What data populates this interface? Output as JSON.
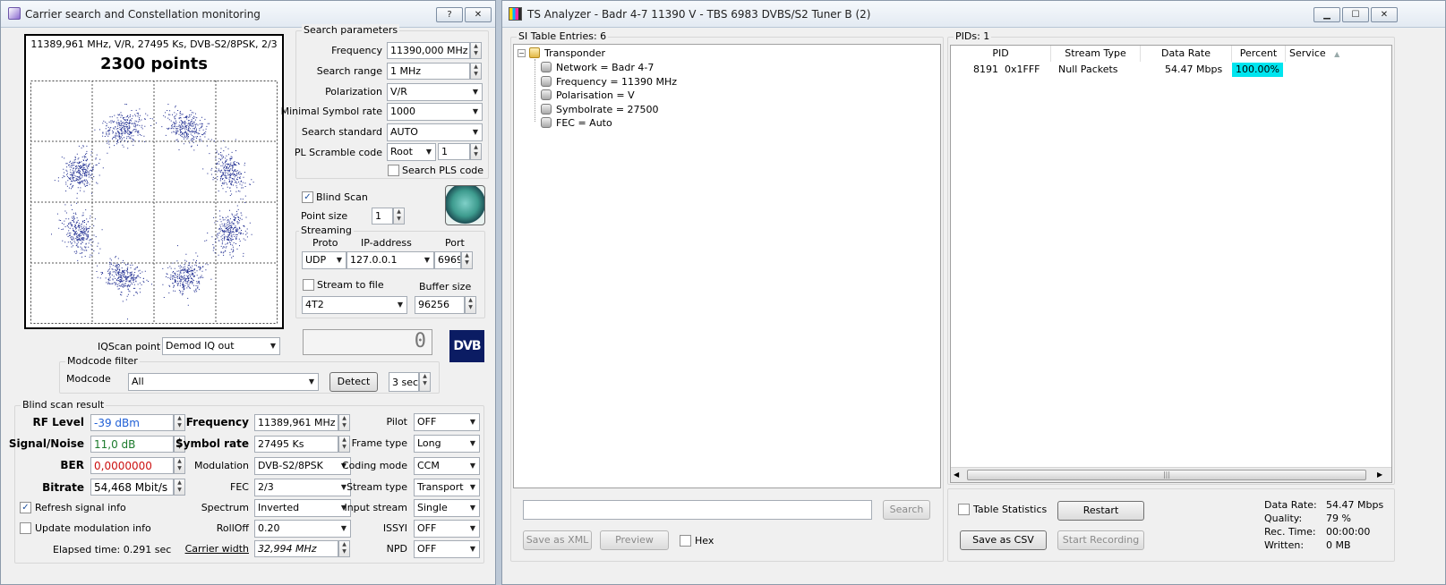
{
  "left": {
    "title": "Carrier search and Constellation monitoring",
    "help_button": "?",
    "info": "11389,961 MHz, V/R, 27495 Ks, DVB-S2/8PSK, 2/3",
    "points": "2300 points",
    "search": {
      "group": "Search parameters",
      "frequency_label": "Frequency",
      "frequency": "11390,000 MHz",
      "range_label": "Search range",
      "range": "1 MHz",
      "polarization_label": "Polarization",
      "polarization": "V/R",
      "minsr_label": "Minimal Symbol rate",
      "minsr": "1000",
      "standard_label": "Search standard",
      "standard": "AUTO",
      "pls_label": "PL Scramble code",
      "pls_mode": "Root",
      "pls_value": "1",
      "search_pls": "Search PLS code"
    },
    "blind_scan": "Blind Scan",
    "point_size_label": "Point size",
    "point_size": "1",
    "streaming": {
      "group": "Streaming",
      "proto_label": "Proto",
      "ip_label": "IP-address",
      "port_label": "Port",
      "proto": "UDP",
      "ip": "127.0.0.1",
      "port": "6969",
      "to_file": "Stream to file",
      "buffer_label": "Buffer size",
      "format": "4T2",
      "buffer": "96256"
    },
    "digit": "0",
    "dvb_logo": "DVB",
    "iqscan_label": "IQScan point",
    "iqscan": "Demod IQ out",
    "modcode": {
      "group": "Modcode filter",
      "label": "Modcode",
      "value": "All",
      "detect": "Detect",
      "sec": "3 sec"
    },
    "result": {
      "group": "Blind scan result",
      "rf_label": "RF Level",
      "rf": "-39 dBm",
      "sn_label": "Signal/Noise",
      "sn": "11,0 dB",
      "ber_label": "BER",
      "ber": "0,0000000",
      "bitrate_label": "Bitrate",
      "bitrate": "54,468 Mbit/s",
      "freq_label": "Frequency",
      "freq": "11389,961 MHz",
      "sr_label": "Symbol rate",
      "sr": "27495 Ks",
      "mod_label": "Modulation",
      "mod": "DVB-S2/8PSK",
      "fec_label": "FEC",
      "fec": "2/3",
      "spectrum_label": "Spectrum",
      "spectrum": "Inverted",
      "rolloff_label": "RollOff",
      "rolloff": "0.20",
      "cw_label": "Carrier width",
      "cw": "32,994 MHz",
      "pilot_label": "Pilot",
      "pilot": "OFF",
      "frametype_label": "Frame type",
      "frametype": "Long",
      "codingmode_label": "Coding mode",
      "codingmode": "CCM",
      "streamtype_label": "Stream type",
      "streamtype": "Transport",
      "inputstream_label": "Input stream",
      "inputstream": "Single",
      "issyi_label": "ISSYI",
      "issyi": "OFF",
      "npd_label": "NPD",
      "npd": "OFF",
      "refresh": "Refresh signal info",
      "update_mod": "Update modulation info",
      "elapsed": "Elapsed time: 0.291 sec"
    },
    "colors": {
      "rf": "#1f5fd6",
      "sn": "#1b7a2c",
      "ber": "#cc1111",
      "dot": "#1c2a8f"
    }
  },
  "right": {
    "title": "TS Analyzer - Badr 4-7 11390 V - TBS 6983 DVBS/S2 Tuner B (2)",
    "si_group": "SI Table Entries: 6",
    "tree": {
      "root": "Transponder",
      "items": [
        "Network = Badr 4-7",
        "Frequency = 11390 MHz",
        "Polarisation = V",
        "Symbolrate = 27500",
        "FEC = Auto"
      ]
    },
    "search_button": "Search",
    "save_xml": "Save as XML",
    "preview": "Preview",
    "hex": "Hex",
    "pids_group": "PIDs: 1",
    "columns": [
      "PID",
      "Stream Type",
      "Data Rate",
      "Percent",
      "Service"
    ],
    "rows": [
      {
        "pid": "8191",
        "hex": "0x1FFF",
        "type": "Null Packets",
        "rate": "54.47 Mbps",
        "percent": "100.00%"
      }
    ],
    "percent_color": "#00e5ef",
    "table_stats": "Table Statistics",
    "restart": "Restart",
    "save_csv": "Save as CSV",
    "start_recording": "Start Recording",
    "stats": [
      {
        "label": "Data Rate:",
        "value": "54.47 Mbps"
      },
      {
        "label": "Quality:",
        "value": "79 %"
      },
      {
        "label": "Rec. Time:",
        "value": "00:00:00"
      },
      {
        "label": "Written:",
        "value": "0 MB"
      }
    ]
  }
}
